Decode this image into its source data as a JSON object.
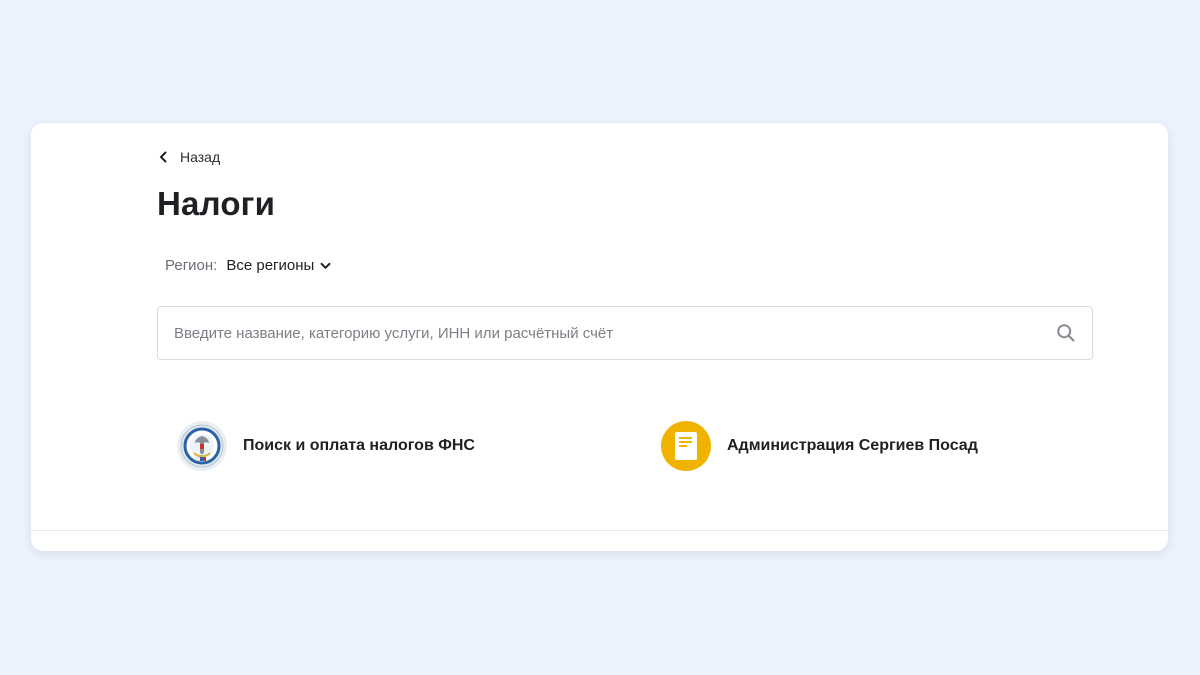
{
  "nav": {
    "back_label": "Назад"
  },
  "page": {
    "title": "Налоги"
  },
  "region": {
    "label": "Регион:",
    "value": "Все регионы"
  },
  "search": {
    "value": "",
    "placeholder": "Введите название, категорию услуги, ИНН или расчётный счёт",
    "icon": "search-icon"
  },
  "services": [
    {
      "name": "Поиск и оплата налогов ФНС",
      "icon": "fns-emblem-icon"
    },
    {
      "name": "Администрация Сергиев Посад",
      "icon": "document-icon"
    }
  ],
  "colors": {
    "background": "#edf3fd",
    "card": "#ffffff",
    "admin_icon_bg": "#f0b400",
    "text": "#1f2023",
    "muted_text": "#6a6d73"
  }
}
